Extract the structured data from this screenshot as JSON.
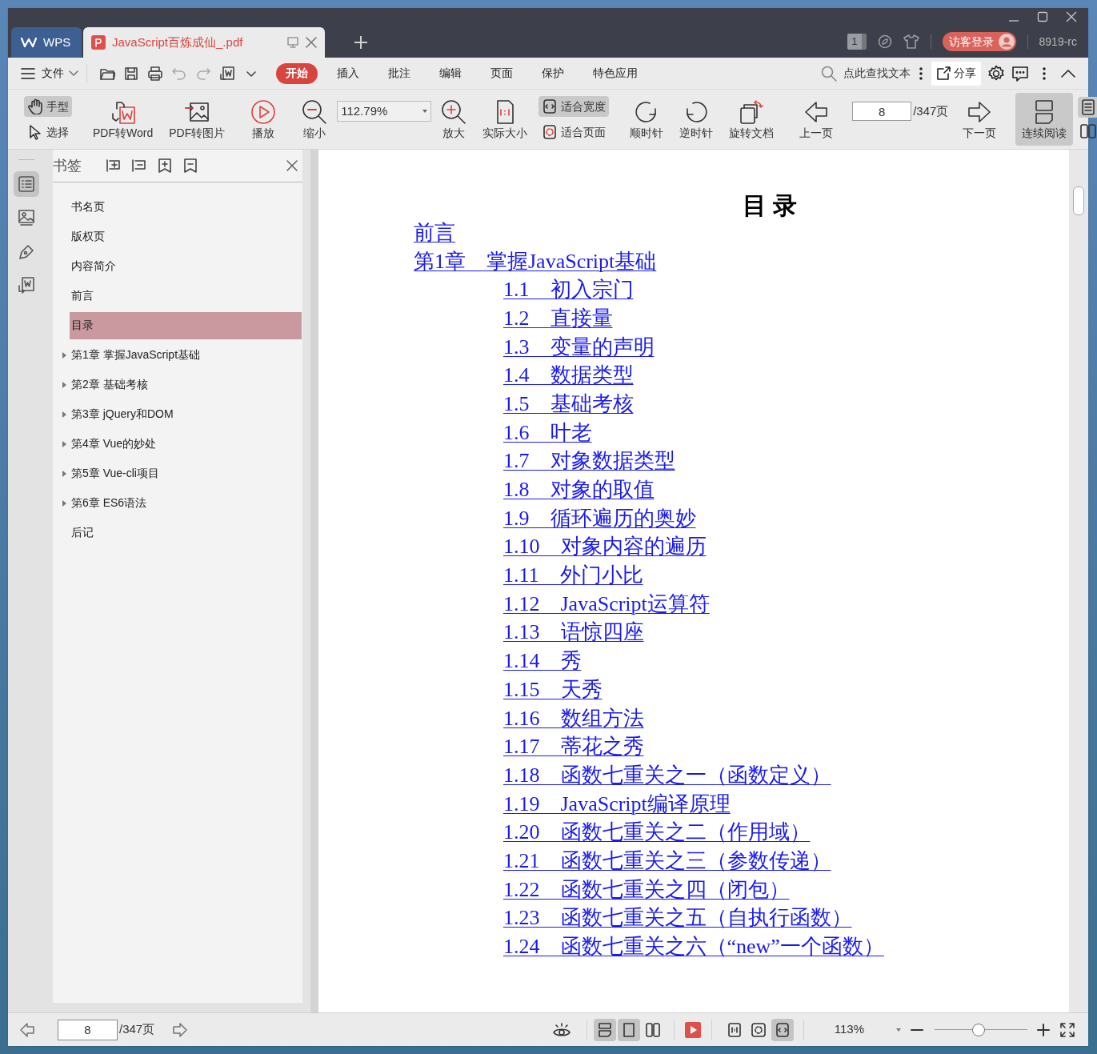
{
  "tabs": [
    {
      "kind": "home",
      "label": "WPS",
      "selected": false
    },
    {
      "kind": "document",
      "label": "JavaScript百炼成仙_.pdf",
      "selected": true
    }
  ],
  "title_bar": {
    "badge": "1",
    "login_button": "访客登录",
    "user": "8919-rc"
  },
  "menu": {
    "file": "文件",
    "tabs": [
      {
        "label": "开始",
        "selected": true
      },
      {
        "label": "插入",
        "selected": false
      },
      {
        "label": "批注",
        "selected": false
      },
      {
        "label": "编辑",
        "selected": false
      },
      {
        "label": "页面",
        "selected": false
      },
      {
        "label": "保护",
        "selected": false
      },
      {
        "label": "特色应用",
        "selected": false
      }
    ],
    "search_placeholder": "点此查找文本",
    "share": "分享"
  },
  "toolbar": {
    "groups": [
      [
        {
          "kind": "stack",
          "items": [
            {
              "label": "手型",
              "selected": true
            },
            {
              "label": "选择",
              "selected": false
            }
          ]
        }
      ],
      [
        {
          "kind": "large",
          "label": "PDF转Word",
          "selected": false
        },
        {
          "kind": "large",
          "label": "PDF转图片",
          "selected": false
        }
      ],
      [
        {
          "kind": "large",
          "label": "播放",
          "selected": false
        }
      ],
      [
        {
          "kind": "large",
          "label": "缩小",
          "selected": false
        },
        {
          "kind": "zoombox",
          "value": "112.79%"
        },
        {
          "kind": "large",
          "label": "放大",
          "selected": false
        },
        {
          "kind": "large",
          "label": "实际大小",
          "selected": false
        },
        {
          "kind": "stack",
          "items": [
            {
              "label": "适合宽度",
              "selected": true
            },
            {
              "label": "适合页面",
              "selected": false
            }
          ]
        }
      ],
      [
        {
          "kind": "large",
          "label": "顺时针",
          "selected": false
        },
        {
          "kind": "large",
          "label": "逆时针",
          "selected": false
        },
        {
          "kind": "large",
          "label": "旋转文档",
          "selected": false
        }
      ],
      [
        {
          "kind": "large",
          "label": "上一页",
          "selected": false
        },
        {
          "kind": "pager",
          "value": "8",
          "total": "/347页"
        },
        {
          "kind": "large",
          "label": "下一页",
          "selected": false
        }
      ],
      [
        {
          "kind": "large",
          "label": "连续阅读",
          "selected": true
        },
        {
          "kind": "iconstack",
          "items": [
            {
              "selected": true
            },
            {
              "selected": false
            }
          ]
        }
      ]
    ]
  },
  "rail": [
    {
      "selected": true
    },
    {
      "selected": false
    },
    {
      "selected": false
    },
    {
      "selected": false
    }
  ],
  "sidebar": {
    "title": "书签",
    "bookmarks": [
      {
        "label": "书名页",
        "selected": false,
        "expandable": false
      },
      {
        "label": "版权页",
        "selected": false,
        "expandable": false
      },
      {
        "label": "内容简介",
        "selected": false,
        "expandable": false
      },
      {
        "label": "前言",
        "selected": false,
        "expandable": false
      },
      {
        "label": "目录",
        "selected": true,
        "expandable": false
      },
      {
        "label": "第1章 掌握JavaScript基础",
        "selected": false,
        "expandable": true
      },
      {
        "label": "第2章 基础考核",
        "selected": false,
        "expandable": true
      },
      {
        "label": "第3章 jQuery和DOM",
        "selected": false,
        "expandable": true
      },
      {
        "label": "第4章 Vue的妙处",
        "selected": false,
        "expandable": true
      },
      {
        "label": "第5章 Vue-cli项目",
        "selected": false,
        "expandable": true
      },
      {
        "label": "第6章 ES6语法",
        "selected": false,
        "expandable": true
      },
      {
        "label": "后记",
        "selected": false,
        "expandable": false
      }
    ]
  },
  "document": {
    "heading": "目 录",
    "entries": [
      {
        "text": "前言"
      },
      {
        "text": "第1章　掌握JavaScript基础",
        "children": [
          {
            "text": "1.1　初入宗门"
          },
          {
            "text": "1.2　直接量"
          },
          {
            "text": "1.3　变量的声明"
          },
          {
            "text": "1.4　数据类型"
          },
          {
            "text": "1.5　基础考核"
          },
          {
            "text": "1.6　叶老"
          },
          {
            "text": "1.7　对象数据类型"
          },
          {
            "text": "1.8　对象的取值"
          },
          {
            "text": "1.9　循环遍历的奥妙"
          },
          {
            "text": "1.10　对象内容的遍历"
          },
          {
            "text": "1.11　外门小比"
          },
          {
            "text": "1.12　JavaScript运算符"
          },
          {
            "text": "1.13　语惊四座"
          },
          {
            "text": "1.14　秀"
          },
          {
            "text": "1.15　天秀"
          },
          {
            "text": "1.16　数组方法"
          },
          {
            "text": "1.17　蒂花之秀"
          },
          {
            "text": "1.18　函数七重关之一（函数定义）"
          },
          {
            "text": "1.19　JavaScript编译原理"
          },
          {
            "text": "1.20　函数七重关之二（作用域）"
          },
          {
            "text": "1.21　函数七重关之三（参数传递）"
          },
          {
            "text": "1.22　函数七重关之四（闭包）"
          },
          {
            "text": "1.23　函数七重关之五（自执行函数）"
          },
          {
            "text": "1.24　函数七重关之六（“new”一个函数）"
          }
        ]
      }
    ]
  },
  "status_bar": {
    "page": "8",
    "total": "/347页",
    "view_modes": [
      {
        "selected": true
      },
      {
        "selected": true
      },
      {
        "selected": false
      }
    ],
    "fit_modes": [
      {
        "selected": false
      },
      {
        "selected": false
      },
      {
        "selected": true
      }
    ],
    "zoom": "113%",
    "zoom_slider": {
      "level": 0.47
    }
  }
}
